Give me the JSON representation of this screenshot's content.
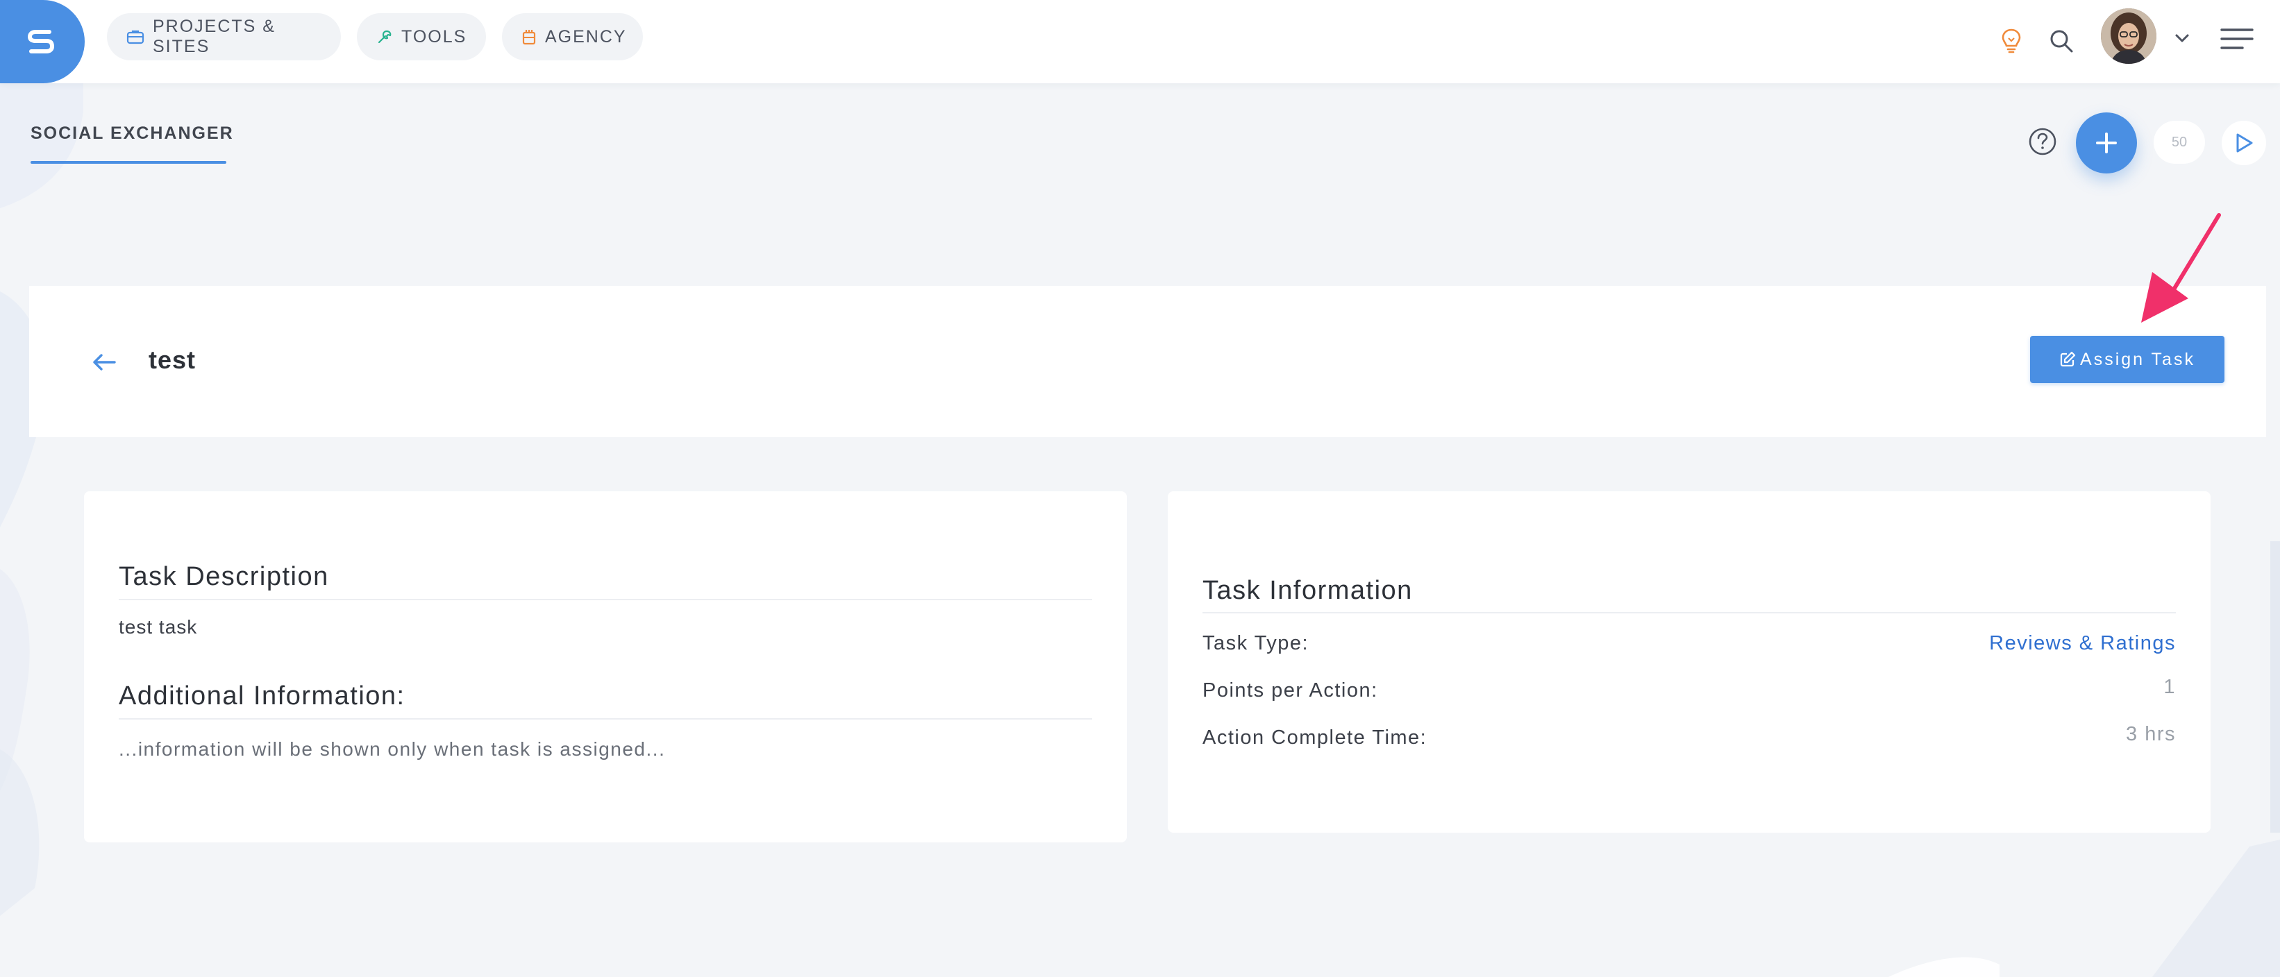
{
  "nav": {
    "projects_label": "PROJECTS & SITES",
    "tools_label": "TOOLS",
    "agency_label": "AGENCY"
  },
  "header": {
    "tab_label": "SOCIAL EXCHANGER",
    "count": "50"
  },
  "task": {
    "title": "test",
    "assign_button_label": "Assign Task"
  },
  "description_card": {
    "heading": "Task Description",
    "text": "test task",
    "additional_heading": "Additional Information:",
    "additional_text": "...information will be shown only when task is assigned..."
  },
  "info_card": {
    "heading": "Task Information",
    "rows": [
      {
        "label": "Task Type:",
        "value": "Reviews & Ratings"
      },
      {
        "label": "Points per Action:",
        "value": "1"
      },
      {
        "label": "Action Complete Time:",
        "value": "3 hrs"
      }
    ]
  },
  "colors": {
    "accent": "#4a8fe3",
    "link": "#2f6fd0",
    "annotation": "#f0306a",
    "background": "#f3f5f8"
  },
  "icons": {
    "logo": "brand-s-logo",
    "projects": "briefcase-icon",
    "tools": "wrench-icon",
    "agency": "building-icon",
    "notifications": "lightbulb-icon",
    "search": "search-icon",
    "menu": "hamburger-icon",
    "help": "question-icon",
    "add": "plus-icon",
    "play": "play-icon",
    "back": "arrow-left-icon",
    "edit": "edit-icon"
  }
}
